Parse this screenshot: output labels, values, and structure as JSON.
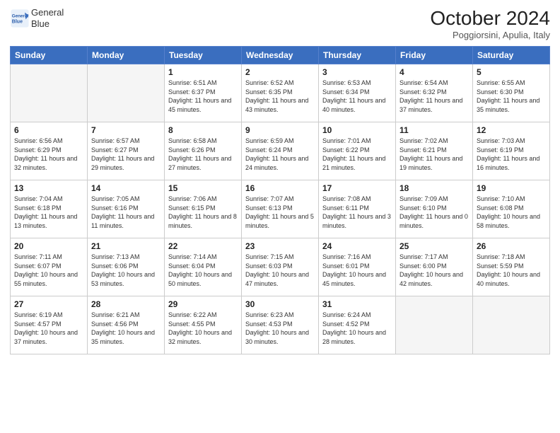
{
  "header": {
    "logo_line1": "General",
    "logo_line2": "Blue",
    "month_year": "October 2024",
    "location": "Poggiorsini, Apulia, Italy"
  },
  "days_of_week": [
    "Sunday",
    "Monday",
    "Tuesday",
    "Wednesday",
    "Thursday",
    "Friday",
    "Saturday"
  ],
  "weeks": [
    [
      {
        "day": "",
        "empty": true
      },
      {
        "day": "",
        "empty": true
      },
      {
        "day": "1",
        "sunrise": "6:51 AM",
        "sunset": "6:37 PM",
        "daylight": "11 hours and 45 minutes."
      },
      {
        "day": "2",
        "sunrise": "6:52 AM",
        "sunset": "6:35 PM",
        "daylight": "11 hours and 43 minutes."
      },
      {
        "day": "3",
        "sunrise": "6:53 AM",
        "sunset": "6:34 PM",
        "daylight": "11 hours and 40 minutes."
      },
      {
        "day": "4",
        "sunrise": "6:54 AM",
        "sunset": "6:32 PM",
        "daylight": "11 hours and 37 minutes."
      },
      {
        "day": "5",
        "sunrise": "6:55 AM",
        "sunset": "6:30 PM",
        "daylight": "11 hours and 35 minutes."
      }
    ],
    [
      {
        "day": "6",
        "sunrise": "6:56 AM",
        "sunset": "6:29 PM",
        "daylight": "11 hours and 32 minutes."
      },
      {
        "day": "7",
        "sunrise": "6:57 AM",
        "sunset": "6:27 PM",
        "daylight": "11 hours and 29 minutes."
      },
      {
        "day": "8",
        "sunrise": "6:58 AM",
        "sunset": "6:26 PM",
        "daylight": "11 hours and 27 minutes."
      },
      {
        "day": "9",
        "sunrise": "6:59 AM",
        "sunset": "6:24 PM",
        "daylight": "11 hours and 24 minutes."
      },
      {
        "day": "10",
        "sunrise": "7:01 AM",
        "sunset": "6:22 PM",
        "daylight": "11 hours and 21 minutes."
      },
      {
        "day": "11",
        "sunrise": "7:02 AM",
        "sunset": "6:21 PM",
        "daylight": "11 hours and 19 minutes."
      },
      {
        "day": "12",
        "sunrise": "7:03 AM",
        "sunset": "6:19 PM",
        "daylight": "11 hours and 16 minutes."
      }
    ],
    [
      {
        "day": "13",
        "sunrise": "7:04 AM",
        "sunset": "6:18 PM",
        "daylight": "11 hours and 13 minutes."
      },
      {
        "day": "14",
        "sunrise": "7:05 AM",
        "sunset": "6:16 PM",
        "daylight": "11 hours and 11 minutes."
      },
      {
        "day": "15",
        "sunrise": "7:06 AM",
        "sunset": "6:15 PM",
        "daylight": "11 hours and 8 minutes."
      },
      {
        "day": "16",
        "sunrise": "7:07 AM",
        "sunset": "6:13 PM",
        "daylight": "11 hours and 5 minutes."
      },
      {
        "day": "17",
        "sunrise": "7:08 AM",
        "sunset": "6:11 PM",
        "daylight": "11 hours and 3 minutes."
      },
      {
        "day": "18",
        "sunrise": "7:09 AM",
        "sunset": "6:10 PM",
        "daylight": "11 hours and 0 minutes."
      },
      {
        "day": "19",
        "sunrise": "7:10 AM",
        "sunset": "6:08 PM",
        "daylight": "10 hours and 58 minutes."
      }
    ],
    [
      {
        "day": "20",
        "sunrise": "7:11 AM",
        "sunset": "6:07 PM",
        "daylight": "10 hours and 55 minutes."
      },
      {
        "day": "21",
        "sunrise": "7:13 AM",
        "sunset": "6:06 PM",
        "daylight": "10 hours and 53 minutes."
      },
      {
        "day": "22",
        "sunrise": "7:14 AM",
        "sunset": "6:04 PM",
        "daylight": "10 hours and 50 minutes."
      },
      {
        "day": "23",
        "sunrise": "7:15 AM",
        "sunset": "6:03 PM",
        "daylight": "10 hours and 47 minutes."
      },
      {
        "day": "24",
        "sunrise": "7:16 AM",
        "sunset": "6:01 PM",
        "daylight": "10 hours and 45 minutes."
      },
      {
        "day": "25",
        "sunrise": "7:17 AM",
        "sunset": "6:00 PM",
        "daylight": "10 hours and 42 minutes."
      },
      {
        "day": "26",
        "sunrise": "7:18 AM",
        "sunset": "5:59 PM",
        "daylight": "10 hours and 40 minutes."
      }
    ],
    [
      {
        "day": "27",
        "sunrise": "6:19 AM",
        "sunset": "4:57 PM",
        "daylight": "10 hours and 37 minutes."
      },
      {
        "day": "28",
        "sunrise": "6:21 AM",
        "sunset": "4:56 PM",
        "daylight": "10 hours and 35 minutes."
      },
      {
        "day": "29",
        "sunrise": "6:22 AM",
        "sunset": "4:55 PM",
        "daylight": "10 hours and 32 minutes."
      },
      {
        "day": "30",
        "sunrise": "6:23 AM",
        "sunset": "4:53 PM",
        "daylight": "10 hours and 30 minutes."
      },
      {
        "day": "31",
        "sunrise": "6:24 AM",
        "sunset": "4:52 PM",
        "daylight": "10 hours and 28 minutes."
      },
      {
        "day": "",
        "empty": true
      },
      {
        "day": "",
        "empty": true
      }
    ]
  ]
}
